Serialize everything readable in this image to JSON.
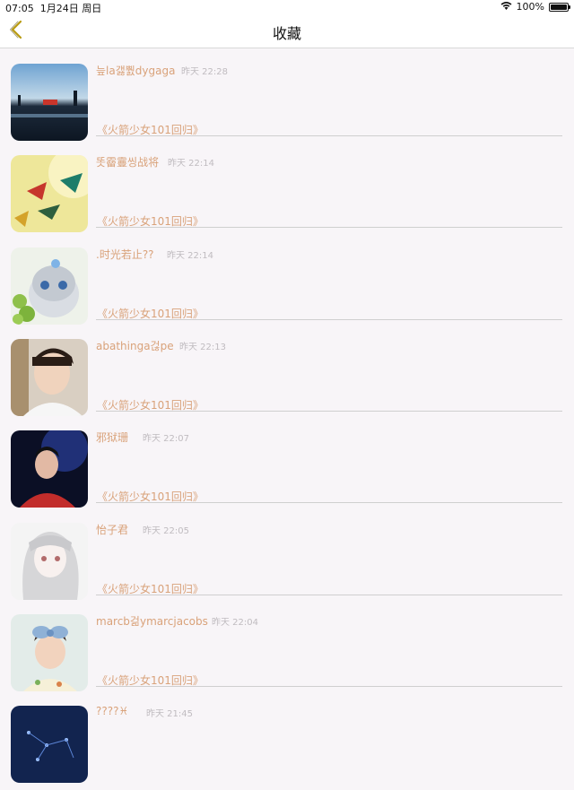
{
  "status_bar": {
    "time": "07:05",
    "date": "1月24日 周日",
    "battery": "100%",
    "battery_level": 1.0
  },
  "nav": {
    "title": "收藏",
    "back_icon": "chevron-left-icon"
  },
  "colors": {
    "accent": "#d9a27a",
    "back_icon": "#b89a10",
    "time_text": "#c0bcc0",
    "background": "#f8f5f8"
  },
  "favorites": [
    {
      "name": "늪la갫뿴dygaga",
      "time": "昨天 22:28",
      "tag": "《火箭少女101回归》",
      "avatar": "night-lake-scene"
    },
    {
      "name": "똣霤霻씽战将",
      "time": "昨天 22:14",
      "tag": "《火箭少女101回归》",
      "avatar": "paper-cranes"
    },
    {
      "name": ".时光若止??",
      "time": "昨天 22:14",
      "tag": "《火箭少女101回归》",
      "avatar": "kitten-illustration"
    },
    {
      "name": "abathinga걶pe",
      "time": "昨天 22:13",
      "tag": "《火箭少女101回归》",
      "avatar": "boy-portrait"
    },
    {
      "name": "邪狱珊",
      "time": "昨天 22:07",
      "tag": "《火箭少女101回归》",
      "avatar": "man-stage-portrait"
    },
    {
      "name": "怡子君",
      "time": "昨天 22:05",
      "tag": "《火箭少女101回归》",
      "avatar": "anime-girl-sketch"
    },
    {
      "name": "marcb걺ymarcjacobs",
      "time": "昨天 22:04",
      "tag": "《火箭少女101回归》",
      "avatar": "baby-with-bow"
    },
    {
      "name": "????♓",
      "time": "昨天 21:45",
      "tag": "",
      "avatar": "constellation-sky"
    }
  ]
}
